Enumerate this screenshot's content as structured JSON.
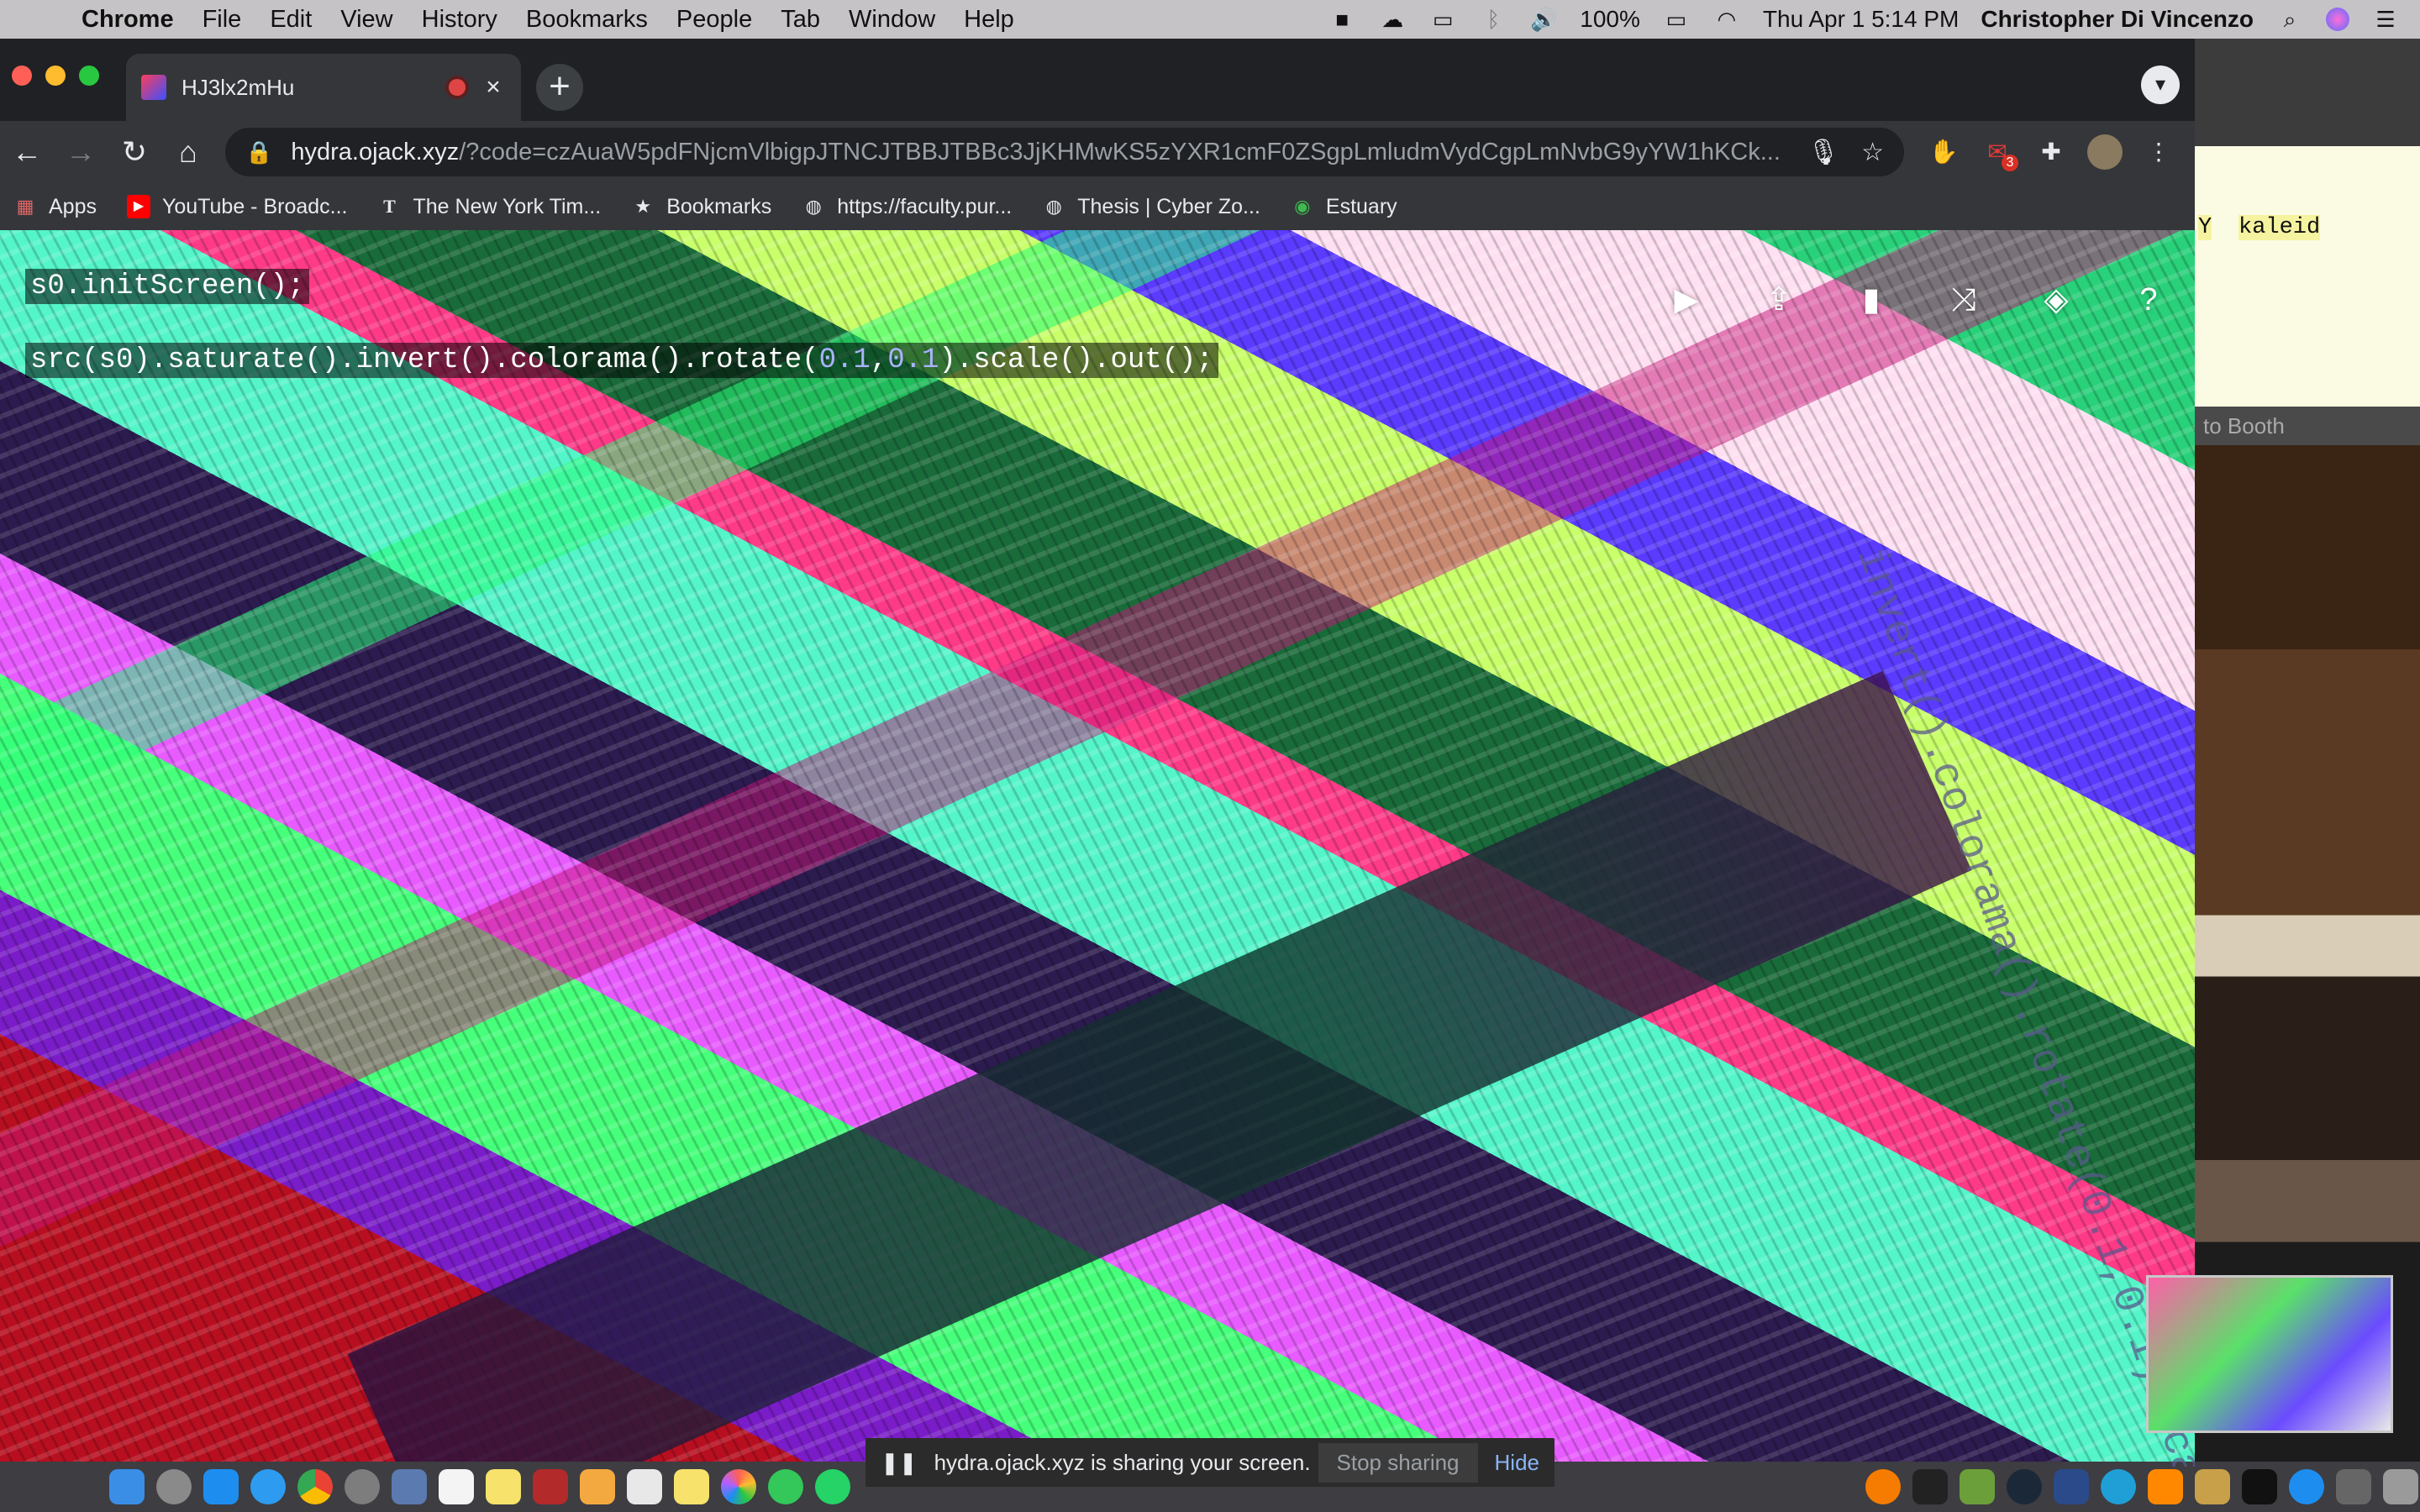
{
  "menubar": {
    "apple": "",
    "app_name": "Chrome",
    "items": [
      "File",
      "Edit",
      "View",
      "History",
      "Bookmarks",
      "People",
      "Tab",
      "Window",
      "Help"
    ],
    "battery": "100%",
    "clock": "Thu Apr 1  5:14 PM",
    "user": "Christopher Di Vincenzo"
  },
  "tab": {
    "title": "HJ3lx2mHu"
  },
  "omnibox": {
    "host": "hydra.ojack.xyz",
    "path": "/?code=czAuaW5pdFNjcmVlbigpJTNCJTBBJTBBc3JjKHMwKS5zYXR1cmF0ZSgpLmludmVydCgpLmNvbG9yYW1hKCk..."
  },
  "extensions": {
    "gmail_badge": "3"
  },
  "bookmarks": [
    {
      "label": "Apps",
      "icon": "apps-grid-icon"
    },
    {
      "label": "YouTube - Broadc...",
      "icon": "youtube-icon"
    },
    {
      "label": "The New York Tim...",
      "icon": "nytimes-icon"
    },
    {
      "label": "Bookmarks",
      "icon": "star-icon"
    },
    {
      "label": "https://faculty.pur...",
      "icon": "globe-icon"
    },
    {
      "label": "Thesis | Cyber Zo...",
      "icon": "globe-icon"
    },
    {
      "label": "Estuary",
      "icon": "estuary-icon"
    }
  ],
  "code": {
    "line1": "s0.initScreen();",
    "line2_pre": "src(s0).saturate().invert().colorama().rotate(",
    "line2_arg1": "0.1",
    "line2_comma": ",",
    "line2_arg2": "0.1",
    "line2_post": ").scale().out();"
  },
  "ghost_code": "invert().colorama().rotate(0.1,0.1).scale()",
  "side_doc": {
    "keyword_a": "Y",
    "keyword_b": "kaleid",
    "bar_label": "to Booth"
  },
  "share_bar": {
    "message": "hydra.ojack.xyz is sharing your screen.",
    "stop_label": "Stop sharing",
    "hide_label": "Hide"
  },
  "colors": {
    "chrome_dark": "#202124",
    "toolbar": "#35363a",
    "menubar": "#c6c3c6"
  }
}
